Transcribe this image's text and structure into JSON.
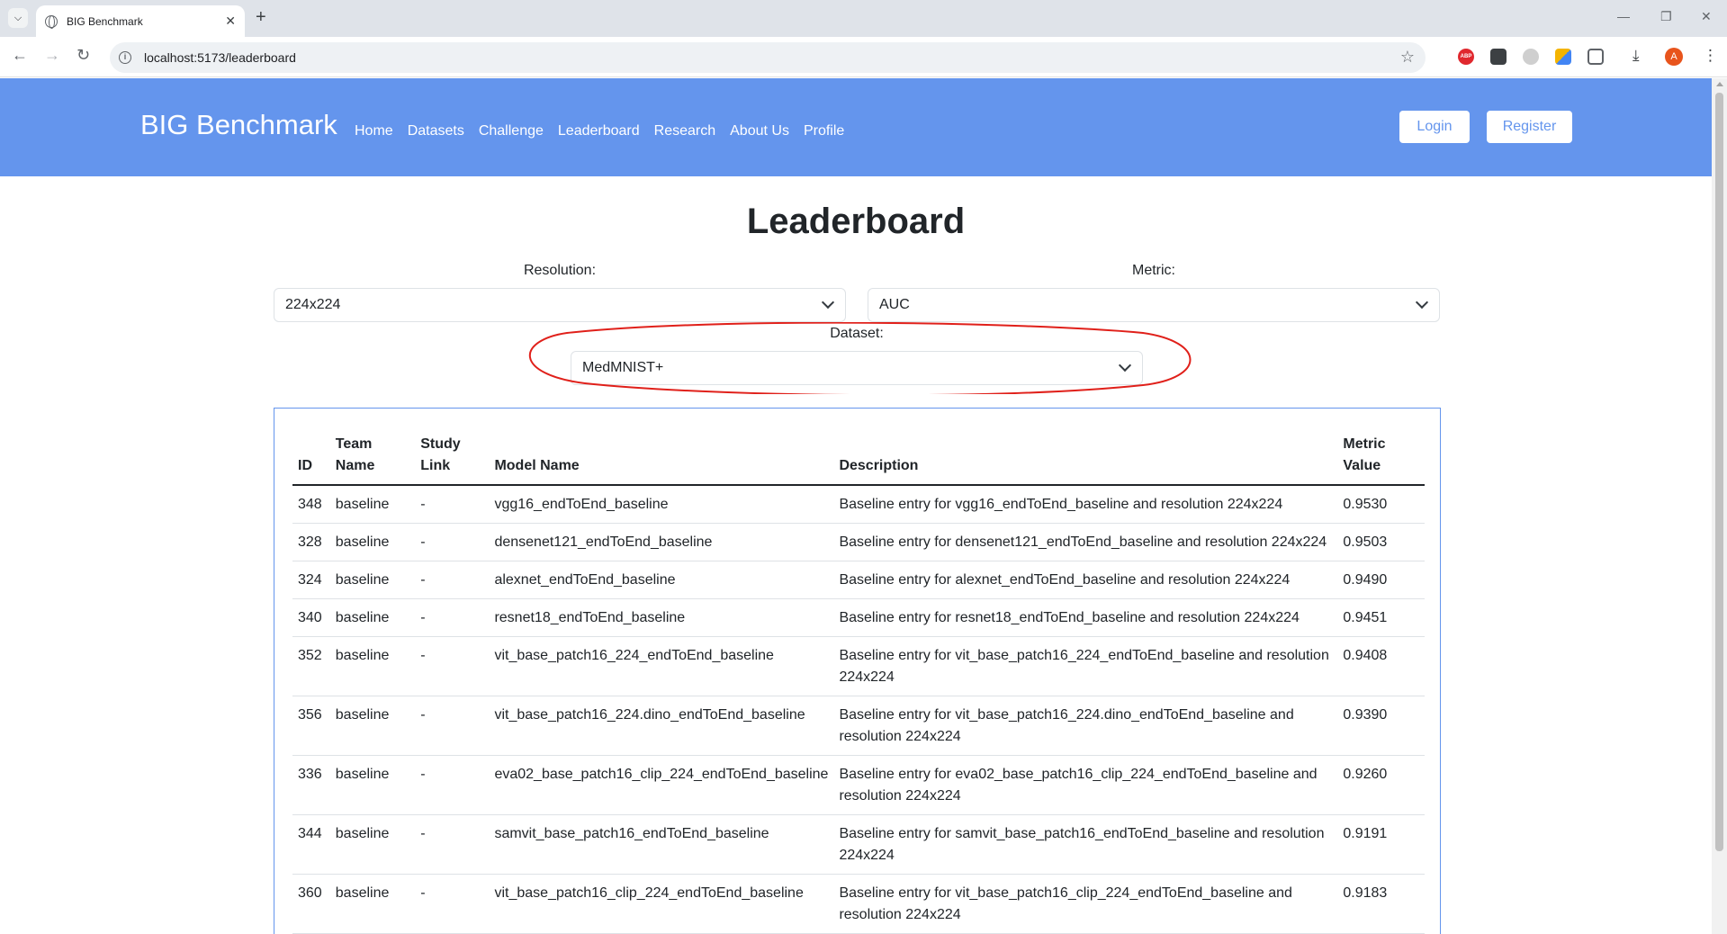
{
  "browser": {
    "tab_title": "BIG Benchmark",
    "url": "localhost:5173/leaderboard",
    "avatar_letter": "A",
    "abp_label": "ABP"
  },
  "site": {
    "brand": "BIG Benchmark",
    "nav": [
      "Home",
      "Datasets",
      "Challenge",
      "Leaderboard",
      "Research",
      "About Us",
      "Profile"
    ],
    "login_label": "Login",
    "register_label": "Register",
    "accent_color": "#6495ed"
  },
  "page": {
    "title": "Leaderboard",
    "resolution_label": "Resolution:",
    "resolution_value": "224x224",
    "metric_label": "Metric:",
    "metric_value": "AUC",
    "dataset_label": "Dataset:",
    "dataset_value": "MedMNIST+",
    "annotation_color": "#e0201a"
  },
  "table": {
    "headers": [
      "ID",
      "Team Name",
      "Study Link",
      "Model Name",
      "Description",
      "Metric Value"
    ],
    "rows": [
      [
        "348",
        "baseline",
        "-",
        "vgg16_endToEnd_baseline",
        "Baseline entry for vgg16_endToEnd_baseline and resolution 224x224",
        "0.9530"
      ],
      [
        "328",
        "baseline",
        "-",
        "densenet121_endToEnd_baseline",
        "Baseline entry for densenet121_endToEnd_baseline and resolution 224x224",
        "0.9503"
      ],
      [
        "324",
        "baseline",
        "-",
        "alexnet_endToEnd_baseline",
        "Baseline entry for alexnet_endToEnd_baseline and resolution 224x224",
        "0.9490"
      ],
      [
        "340",
        "baseline",
        "-",
        "resnet18_endToEnd_baseline",
        "Baseline entry for resnet18_endToEnd_baseline and resolution 224x224",
        "0.9451"
      ],
      [
        "352",
        "baseline",
        "-",
        "vit_base_patch16_224_endToEnd_baseline",
        "Baseline entry for vit_base_patch16_224_endToEnd_baseline and resolution 224x224",
        "0.9408"
      ],
      [
        "356",
        "baseline",
        "-",
        "vit_base_patch16_224.dino_endToEnd_baseline",
        "Baseline entry for vit_base_patch16_224.dino_endToEnd_baseline and resolution 224x224",
        "0.9390"
      ],
      [
        "336",
        "baseline",
        "-",
        "eva02_base_patch16_clip_224_endToEnd_baseline",
        "Baseline entry for eva02_base_patch16_clip_224_endToEnd_baseline and resolution 224x224",
        "0.9260"
      ],
      [
        "344",
        "baseline",
        "-",
        "samvit_base_patch16_endToEnd_baseline",
        "Baseline entry for samvit_base_patch16_endToEnd_baseline and resolution 224x224",
        "0.9191"
      ],
      [
        "360",
        "baseline",
        "-",
        "vit_base_patch16_clip_224_endToEnd_baseline",
        "Baseline entry for vit_base_patch16_clip_224_endToEnd_baseline and resolution 224x224",
        "0.9183"
      ]
    ]
  }
}
